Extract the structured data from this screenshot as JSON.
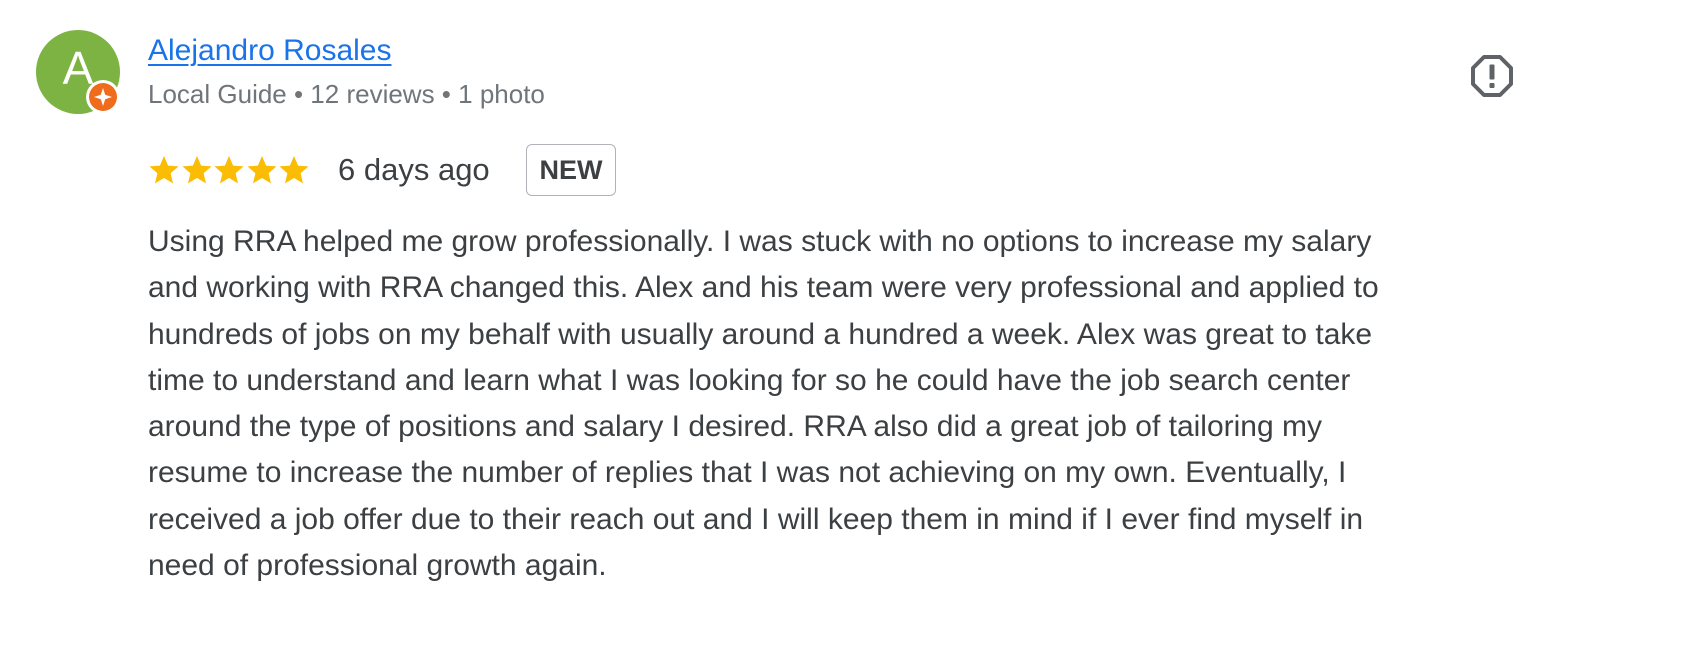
{
  "author": {
    "avatar_letter": "A",
    "avatar_color": "#7cb342",
    "badge_icon": "local-guide-badge-icon",
    "badge_color": "#ef6c1d",
    "name": "Alejandro Rosales",
    "meta": "Local Guide • 12 reviews • 1 photo"
  },
  "actions": {
    "report_icon": "report-octagon-icon"
  },
  "review": {
    "rating": 5,
    "max_rating": 5,
    "star_color": "#fbbc04",
    "date": "6 days ago",
    "badge": "NEW",
    "lines": [
      "Using RRA helped me grow professionally. I was stuck with no options to increase my salary",
      "and working with RRA changed this. Alex and his team were very professional and applied to",
      "hundreds of jobs on my behalf with usually around a hundred a week. Alex was great to take",
      "time to understand and learn what I was looking for so he could have the job search center",
      "around the type of positions and salary I desired. RRA also did a great job of tailoring my",
      "resume to increase the number of replies that I was not achieving on my own. Eventually, I",
      "received a job offer due to their reach out and I will keep them in mind if I ever find myself in",
      "need of professional growth again."
    ]
  }
}
